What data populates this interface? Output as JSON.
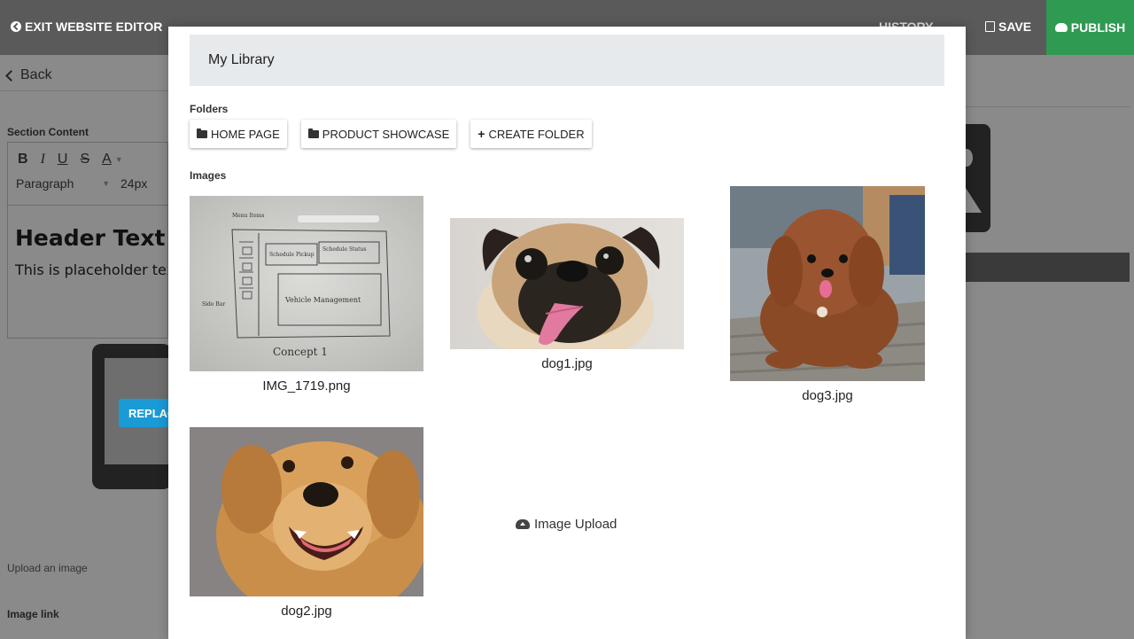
{
  "topbar": {
    "exit_label": "EXIT WEBSITE EDITOR",
    "history_label": "HISTORY",
    "save_label": "SAVE",
    "publish_label": "PUBLISH"
  },
  "sidebar": {
    "back_label": "Back",
    "section_content_label": "Section Content",
    "toolbar": {
      "bold": "B",
      "italic": "I",
      "underline": "U",
      "strike": "S",
      "color": "A",
      "block_format": "Paragraph",
      "font_size": "24px"
    },
    "editor": {
      "heading": "Header Text",
      "paragraph": "This is placeholder text"
    },
    "replace_label": "REPLACE",
    "upload_label": "Upload an image",
    "image_link_label": "Image link"
  },
  "modal": {
    "title": "My Library",
    "folders_label": "Folders",
    "folders": [
      {
        "label": "HOME PAGE"
      },
      {
        "label": "PRODUCT SHOWCASE"
      }
    ],
    "create_folder_label": "CREATE FOLDER",
    "images_label": "Images",
    "images": [
      {
        "name": "IMG_1719.png"
      },
      {
        "name": "dog1.jpg"
      },
      {
        "name": "dog3.jpg"
      },
      {
        "name": "dog2.jpg"
      }
    ],
    "upload_label": "Image Upload",
    "sketch_texts": {
      "menu": "Menu Items",
      "schedule_pickup": "Schedule Pickup",
      "schedule_status": "Schedule Status",
      "vehicle_management": "Vehicle Management",
      "side_label": "Side Bar",
      "concept": "Concept 1"
    }
  },
  "colors": {
    "publish_green": "#2f9a52",
    "replace_blue": "#1a9bd6",
    "library_header_bg": "#e7eaed"
  }
}
